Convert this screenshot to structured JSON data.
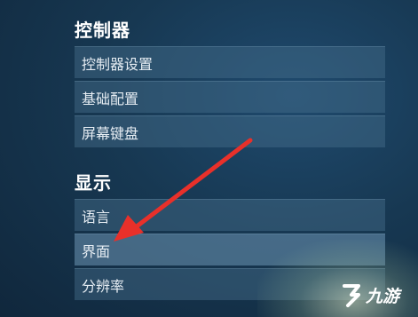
{
  "sections": [
    {
      "title": "控制器",
      "items": [
        "控制器设置",
        "基础配置",
        "屏幕键盘"
      ]
    },
    {
      "title": "显示",
      "items": [
        "语言",
        "界面",
        "分辨率"
      ]
    }
  ],
  "logo": {
    "text": "九游"
  },
  "colors": {
    "arrow": "#e8302a",
    "background": "#173852"
  }
}
